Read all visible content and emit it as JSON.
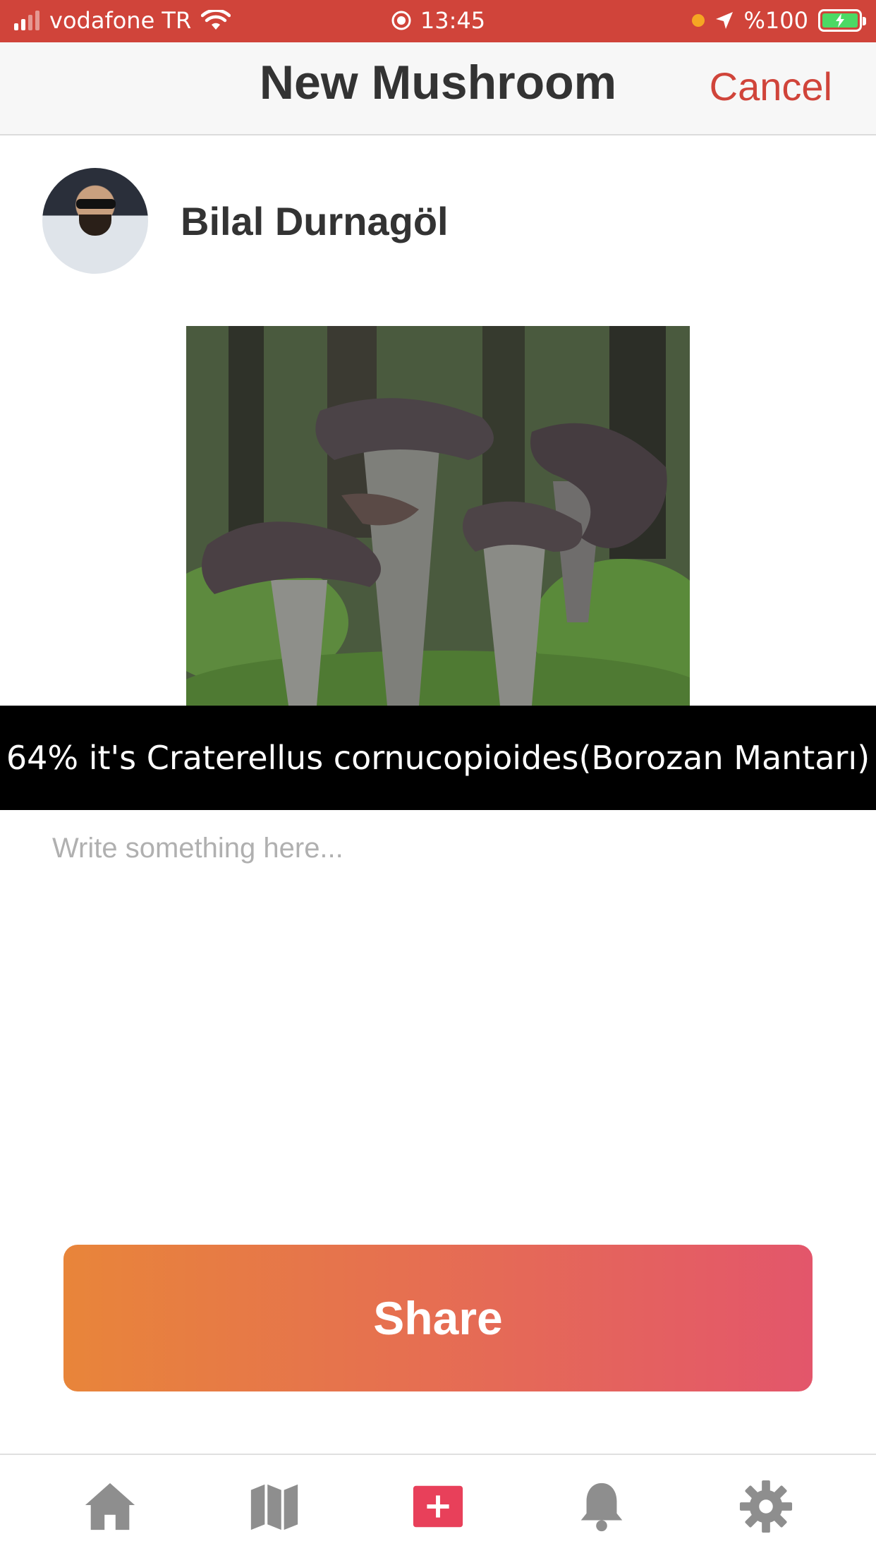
{
  "status_bar": {
    "carrier": "vodafone TR",
    "time": "13:45",
    "battery": "%100"
  },
  "nav": {
    "title": "New Mushroom",
    "cancel_label": "Cancel"
  },
  "user": {
    "name": "Bilal Durnagöl"
  },
  "prediction": {
    "text": "64% it's Craterellus cornucopioides(Borozan Mantarı)"
  },
  "note": {
    "placeholder": "Write something here..."
  },
  "share": {
    "label": "Share"
  },
  "tabs": [
    {
      "icon": "home-icon"
    },
    {
      "icon": "map-icon"
    },
    {
      "icon": "add-icon"
    },
    {
      "icon": "bell-icon"
    },
    {
      "icon": "gear-icon"
    }
  ],
  "colors": {
    "status_bar": "#d0443a",
    "accent": "#d0443a",
    "share_gradient_start": "#e8853a",
    "share_gradient_end": "#e3566b",
    "add_tab": "#e8405a",
    "tab_icon": "#8e8e8e"
  }
}
